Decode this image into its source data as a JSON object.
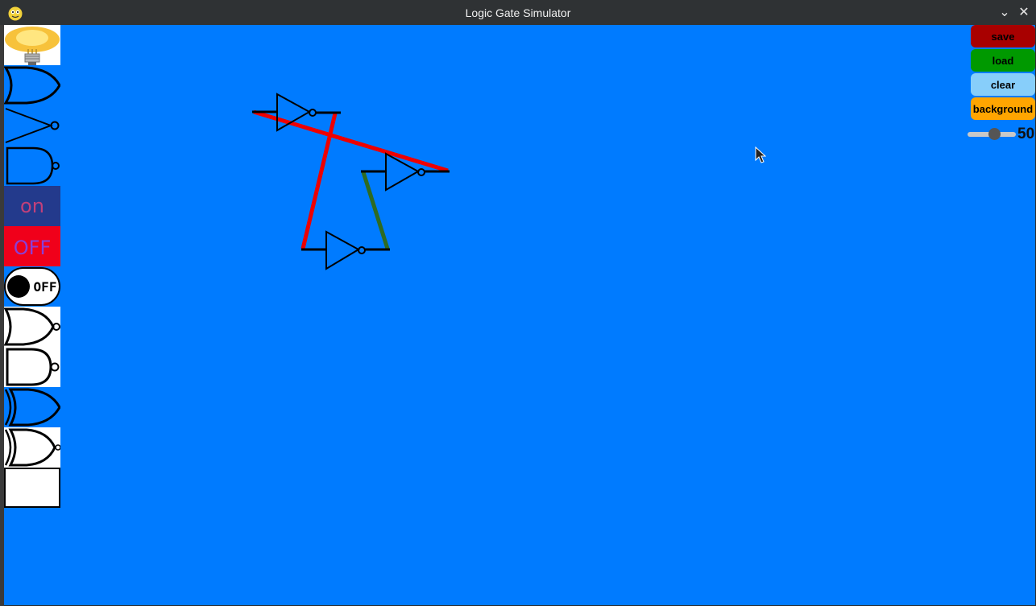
{
  "window": {
    "title": "Logic Gate Simulator",
    "minimize_glyph": "⌄",
    "close_glyph": "✕"
  },
  "palette": [
    {
      "name": "lightbulb-icon"
    },
    {
      "name": "or-gate-icon"
    },
    {
      "name": "not-gate-icon"
    },
    {
      "name": "nand-gate-icon"
    },
    {
      "name": "on-input-icon",
      "text": "on"
    },
    {
      "name": "off-input-icon",
      "text": "OFF"
    },
    {
      "name": "toggle-switch-icon",
      "text": "OFF"
    },
    {
      "name": "nor-gate-icon"
    },
    {
      "name": "and-nand-gate-icon"
    },
    {
      "name": "xor-gate-icon"
    },
    {
      "name": "xnor-gate-icon"
    },
    {
      "name": "empty-block-icon"
    }
  ],
  "controls": {
    "save_label": "save",
    "load_label": "load",
    "clear_label": "clear",
    "background_label": "background",
    "slider_value": "50"
  },
  "colors": {
    "canvas_bg": "#007bff",
    "save": "#a80000",
    "load": "#009900",
    "clear": "#87cefa",
    "background": "#ffa500",
    "wire_active": "#ee0000",
    "wire_inactive": "#2e6b22"
  }
}
